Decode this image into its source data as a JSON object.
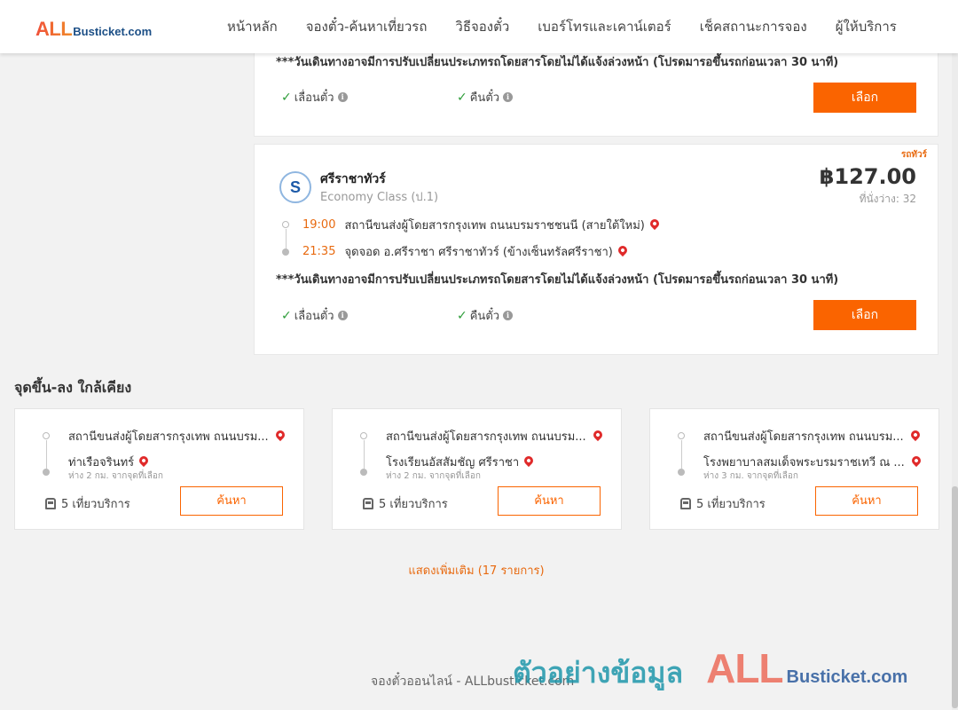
{
  "header": {
    "logo_all": "ALL",
    "logo_rest": "Busticket.com",
    "nav": [
      "หน้าหลัก",
      "จองตั๋ว-ค้นหาเที่ยวรถ",
      "วิธีจองตั๋ว",
      "เบอร์โทรและเคาน์เตอร์",
      "เช็คสถานะการจอง",
      "ผู้ให้บริการ"
    ]
  },
  "trips": [
    {
      "notice": "***วันเดินทางอาจมีการปรับเปลี่ยนประเภทรถโดยสารโดยไม่ได้แจ้งล่วงหน้า (โปรดมารอขึ้นรถก่อนเวลา 30 นาที)",
      "feature_1": "เลื่อนตั๋ว",
      "feature_2": "คืนตั๋ว",
      "select_label": "เลือก"
    },
    {
      "tag": "รถทัวร์",
      "operator": "ศรีราชาทัวร์",
      "class": "Economy Class (ป.1)",
      "price": "฿127.00",
      "seats": "ที่นั่งว่าง: 32",
      "depart_time": "19:00",
      "depart_place": "สถานีขนส่งผู้โดยสารกรุงเทพ ถนนบรมราชชนนี (สายใต้ใหม่)",
      "arrive_time": "21:35",
      "arrive_place": "จุดจอด อ.ศรีราชา ศรีราชาทัวร์ (ข้างเซ็นทรัลศรีราชา)",
      "notice": "***วันเดินทางอาจมีการปรับเปลี่ยนประเภทรถโดยสารโดยไม่ได้แจ้งล่วงหน้า (โปรดมารอขึ้นรถก่อนเวลา 30 นาที)",
      "feature_1": "เลื่อนตั๋ว",
      "feature_2": "คืนตั๋ว",
      "select_label": "เลือก"
    }
  ],
  "nearby": {
    "title": "จุดขึ้น-ลง ใกล้เคียง",
    "cards": [
      {
        "from": "สถานีขนส่งผู้โดยสารกรุงเทพ ถนนบรม...",
        "to": "ท่าเรือจรินทร์",
        "distance": "ห่าง 2 กม. จากจุดที่เลือก",
        "trips": "5 เที่ยวบริการ",
        "search_label": "ค้นหา"
      },
      {
        "from": "สถานีขนส่งผู้โดยสารกรุงเทพ ถนนบรม...",
        "to": "โรงเรียนอัสสัมชัญ ศรีราชา",
        "distance": "ห่าง 2 กม. จากจุดที่เลือก",
        "trips": "5 เที่ยวบริการ",
        "search_label": "ค้นหา"
      },
      {
        "from": "สถานีขนส่งผู้โดยสารกรุงเทพ ถนนบรม...",
        "to": "โรงพยาบาลสมเด็จพระบรมราชเทวี ณ ...",
        "distance": "ห่าง 3 กม. จากจุดที่เลือก",
        "trips": "5 เที่ยวบริการ",
        "search_label": "ค้นหา"
      }
    ],
    "show_more": "แสดงเพิ่มเติม (17 รายการ)"
  },
  "footer": {
    "text": "จองตั๋วออนไลน์ - ALLbusticket.com"
  },
  "watermark": {
    "thai": "ตัวอย่างข้อมูล",
    "all": "ALL",
    "rest": "Busticket.com"
  },
  "colors": {
    "accent": "#fa6400",
    "price_orange": "#e86a10",
    "check_green": "#2e9d3a",
    "pin_red": "#e02a2a"
  }
}
